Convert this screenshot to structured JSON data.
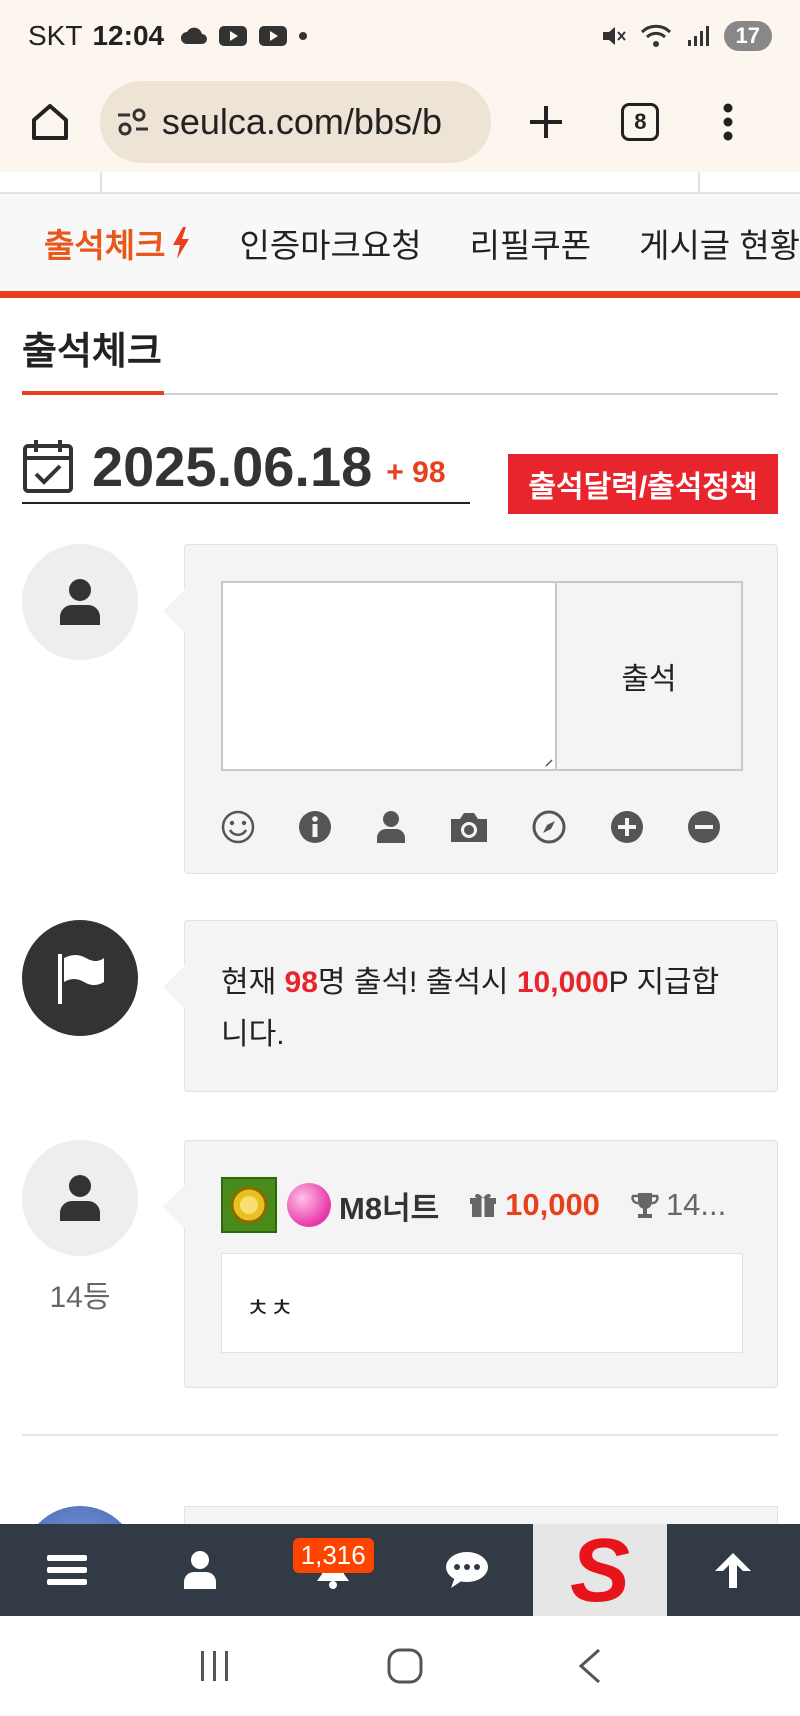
{
  "status_bar": {
    "carrier": "SKT",
    "time": "12:04",
    "battery": "17"
  },
  "browser": {
    "url": "seulca.com/bbs/b",
    "tab_count": "8"
  },
  "tabs": [
    {
      "label": "출석체크",
      "active": true
    },
    {
      "label": "인증마크요청",
      "active": false
    },
    {
      "label": "리필쿠폰",
      "active": false
    },
    {
      "label": "게시글 현황",
      "active": false
    }
  ],
  "section": {
    "title": "출석체크"
  },
  "date": {
    "value": "2025.06.18",
    "plus": "+ 98",
    "calendar_button": "출석달력/출석정책"
  },
  "attend_form": {
    "button": "출석",
    "tools": [
      "smile-icon",
      "info-icon",
      "user-icon",
      "camera-icon",
      "compass-icon",
      "plus-circle-icon",
      "minus-circle-icon"
    ]
  },
  "notice": {
    "prefix": "현재 ",
    "count": "98",
    "middle": "명 출석! 출석시 ",
    "points": "10,000",
    "suffix": "P 지급합니다."
  },
  "entry": {
    "username": "M8너트",
    "points": "10,000",
    "rank_short": "14...",
    "comment": "ㅊㅊ",
    "rank_label": "14등"
  },
  "bottom_nav": {
    "notification_badge": "1,316",
    "logo_letter": "S"
  },
  "colors": {
    "accent": "#e8401c",
    "red_button": "#e8242c",
    "nav_bg": "#323a46"
  }
}
